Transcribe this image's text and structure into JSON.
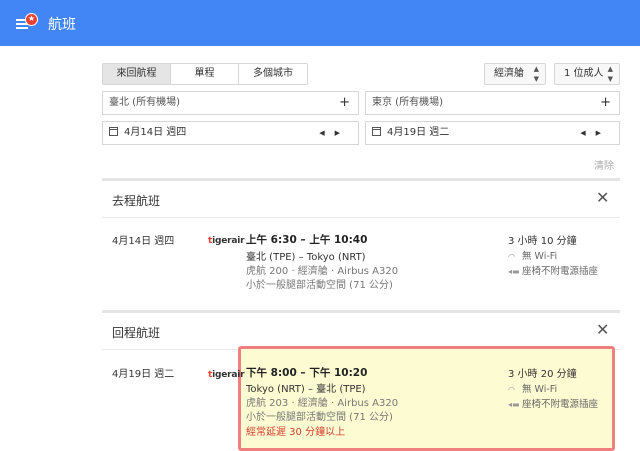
{
  "header": {
    "title": "航班",
    "menu_icon": "menu-icon",
    "badge_icon": "star-icon"
  },
  "trip_types": [
    {
      "label": "來回航程",
      "active": true
    },
    {
      "label": "單程",
      "active": false
    },
    {
      "label": "多個城市",
      "active": false
    }
  ],
  "cabin": {
    "value": "經濟艙"
  },
  "passengers": {
    "value": "1 位成人"
  },
  "origin": {
    "placeholder": "臺北 (所有機場)"
  },
  "destination": {
    "placeholder": "東京 (所有機場)"
  },
  "depart_date": {
    "value": "4月14日 週四"
  },
  "return_date": {
    "value": "4月19日 週二"
  },
  "clear_label": "清除",
  "outbound": {
    "section_title": "去程航班",
    "date": "4月14日 週四",
    "airline_logo": "tigerair",
    "times": "上午 6:30 – 上午 10:40",
    "route": "臺北 (TPE) – Tokyo (NRT)",
    "details": "虎航 200 · 經濟艙 · Airbus A320",
    "legroom": "小於一般腿部活動空間 (71 公分)",
    "duration": "3 小時 10 分鐘",
    "wifi": "無 Wi-Fi",
    "power": "座椅不附電源插座"
  },
  "return": {
    "section_title": "回程航班",
    "date": "4月19日 週二",
    "airline_logo": "tigerair",
    "times": "下午 8:00 – 下午 10:20",
    "route": "Tokyo (NRT) – 臺北 (TPE)",
    "details": "虎航 203 · 經濟艙 · Airbus A320",
    "legroom": "小於一般腿部活動空間 (71 公分)",
    "delay": "經常延遲 30 分鐘以上",
    "duration": "3 小時 20 分鐘",
    "wifi": "無 Wi-Fi",
    "power": "座椅不附電源插座"
  },
  "colors": {
    "header": "#4285f4",
    "delay": "#d23f31",
    "highlight_border": "#f08080",
    "highlight_bg": "#fdfbd2"
  }
}
